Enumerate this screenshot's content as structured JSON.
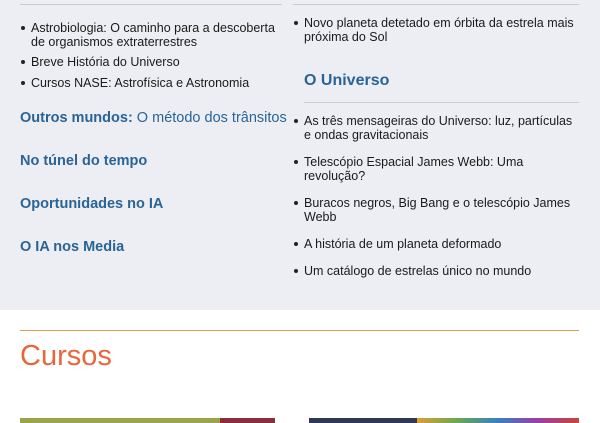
{
  "left": {
    "links": [
      "Astrobiologia: O caminho para a descoberta de organismos extraterrestres",
      "Breve História do Universo",
      "Cursos NASE: Astrofísica e Astronomia"
    ],
    "outros_mundos": {
      "bold": "Outros mundos:",
      "rest": " O método dos trânsitos"
    },
    "tunel": "No túnel do tempo",
    "oportunidades": "Oportunidades no IA",
    "media": "O IA nos Media"
  },
  "right": {
    "top_link": "Novo planeta detetado em órbita da estrela mais próxima do Sol",
    "universo_title": "O Universo",
    "universo_links": [
      "As três mensageiras do Universo: luz, partículas e ondas gravitacionais",
      "Telescópio Espacial James Webb: Uma revolução?",
      "Buracos negros, Big Bang e o telescópio James Webb",
      "A história de um planeta deformado",
      "Um catálogo de estrelas único no mundo"
    ]
  },
  "cursos": {
    "title": "Cursos"
  },
  "colors": {
    "accent_blue": "#2a6496",
    "accent_orange": "#e8663d",
    "menu_bg": "#eceef3"
  }
}
